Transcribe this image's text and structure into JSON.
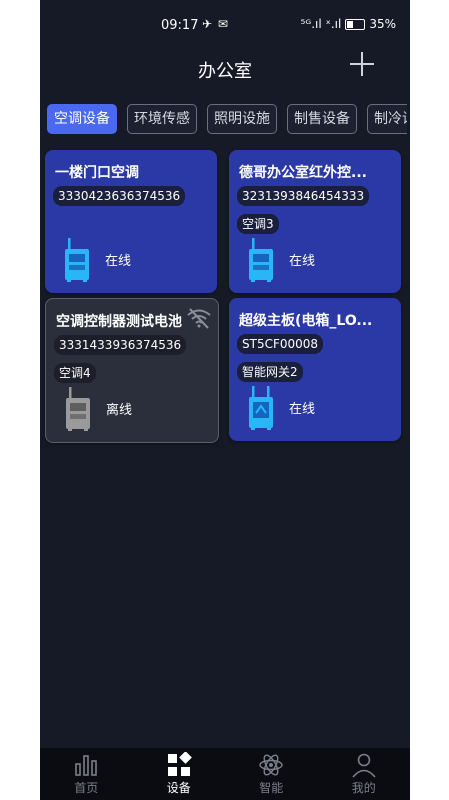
{
  "status_bar": {
    "time": "09:17",
    "icons_left": "✈ ✉",
    "signal": "⁵ᴳ.ıl ˣ.ıl",
    "battery": "35%"
  },
  "header": {
    "title": "办公室",
    "add_icon": "plus-icon"
  },
  "tabs": [
    {
      "label": "空调设备",
      "active": true
    },
    {
      "label": "环境传感",
      "active": false
    },
    {
      "label": "照明设施",
      "active": false
    },
    {
      "label": "制售设备",
      "active": false
    },
    {
      "label": "制冷设备",
      "active": false
    }
  ],
  "devices": [
    {
      "name": "一楼门口空调",
      "id": "3330423636374536",
      "tag": "",
      "status": "在线",
      "online": true
    },
    {
      "name": "德哥办公室红外控...",
      "id": "3231393846454333",
      "tag": "空调3",
      "status": "在线",
      "online": true
    },
    {
      "name": "空调控制器测试电池",
      "id": "3331433936374536",
      "tag": "空调4",
      "status": "离线",
      "online": false
    },
    {
      "name": "超级主板(电箱_LO...",
      "id": "ST5CF00008",
      "tag": "智能网关2",
      "status": "在线",
      "online": true
    }
  ],
  "bottom_nav": [
    {
      "label": "首页",
      "icon": "bar-chart-icon",
      "active": false
    },
    {
      "label": "设备",
      "icon": "grid-blocks-icon",
      "active": true
    },
    {
      "label": "智能",
      "icon": "atom-icon",
      "active": false
    },
    {
      "label": "我的",
      "icon": "person-icon",
      "active": false
    }
  ],
  "colors": {
    "background": "#161a26",
    "card_online": "#2a39a6",
    "card_offline": "#2b2f3b",
    "tab_active": "#4a68f0",
    "device_icon_online": "#29b6f6",
    "device_icon_offline": "#8a8a8a"
  }
}
